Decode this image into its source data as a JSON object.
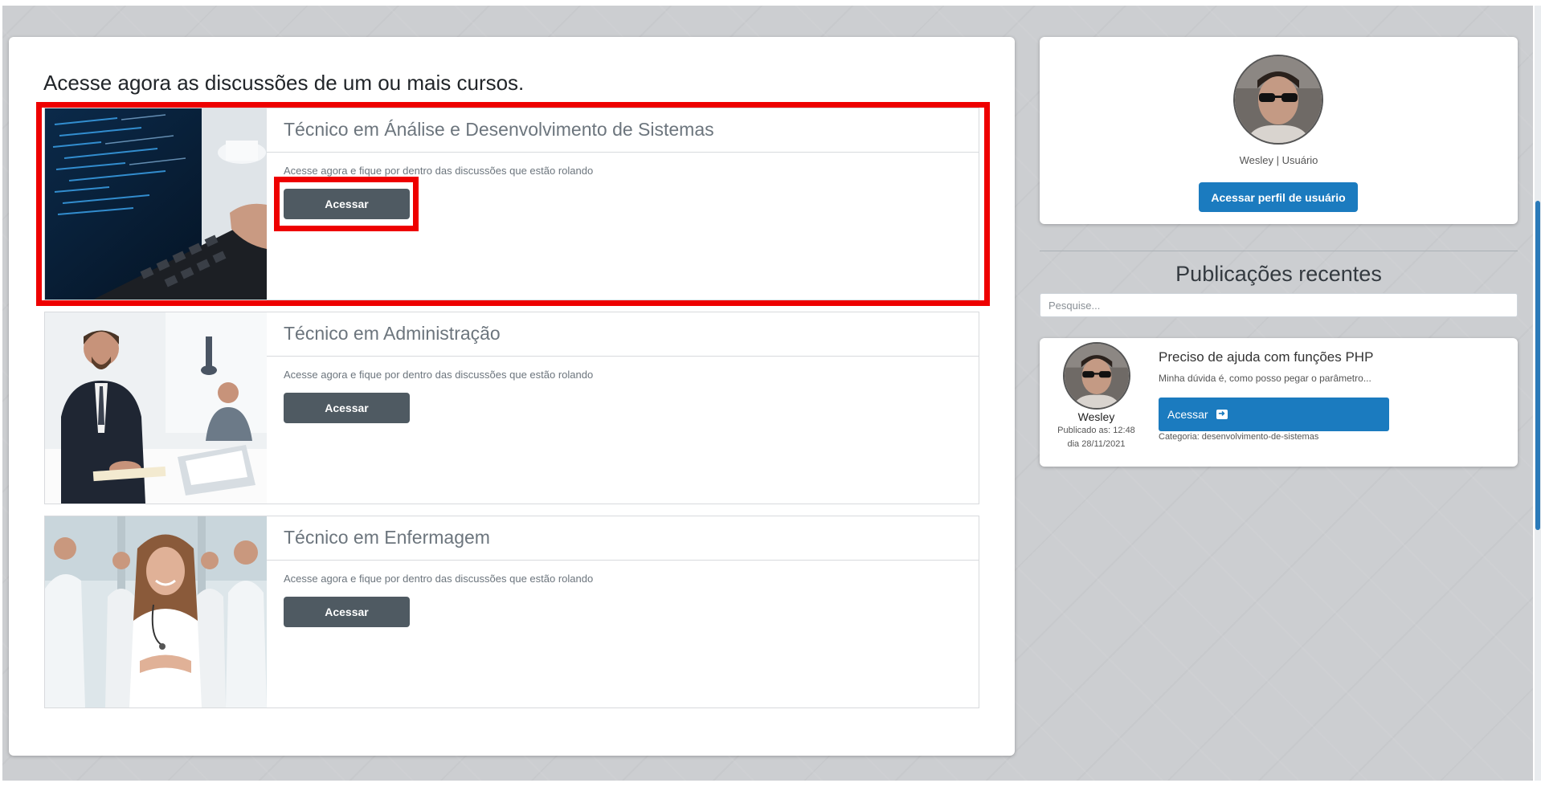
{
  "main": {
    "title": "Acesse agora as discussões de um ou mais cursos.",
    "courses": [
      {
        "title": "Técnico em Ánálise e Desenvolvimento de Sistemas",
        "description": "Acesse agora e fique por dentro das discussões que estão rolando",
        "button_label": "Acessar",
        "image": "laptop-code-photo"
      },
      {
        "title": "Técnico em Administração",
        "description": "Acesse agora e fique por dentro das discussões que estão rolando",
        "button_label": "Acessar",
        "image": "business-office-photo"
      },
      {
        "title": "Técnico em Enfermagem",
        "description": "Acesse agora e fique por dentro das discussões que estão rolando",
        "button_label": "Acessar",
        "image": "nurses-team-photo"
      }
    ]
  },
  "profile": {
    "name": "Wesley | Usuário",
    "button_label": "Acessar perfil de usuário"
  },
  "recent": {
    "title": "Publicações recentes",
    "search_placeholder": "Pesquise...",
    "post": {
      "author": "Wesley",
      "published_time": "Publicado as: 12:48",
      "published_date": "dia 28/11/2021",
      "title": "Preciso de ajuda com funções PHP",
      "excerpt": "Minha dúvida é, como posso pegar o parâmetro...",
      "button_label": "Acessar",
      "category": "Categoria: desenvolvimento-de-sistemas"
    }
  },
  "colors": {
    "highlight": "#ee0000",
    "primary_blue": "#1b7bbf",
    "dark_button": "#4f5a62",
    "page_background": "#ccced1"
  }
}
